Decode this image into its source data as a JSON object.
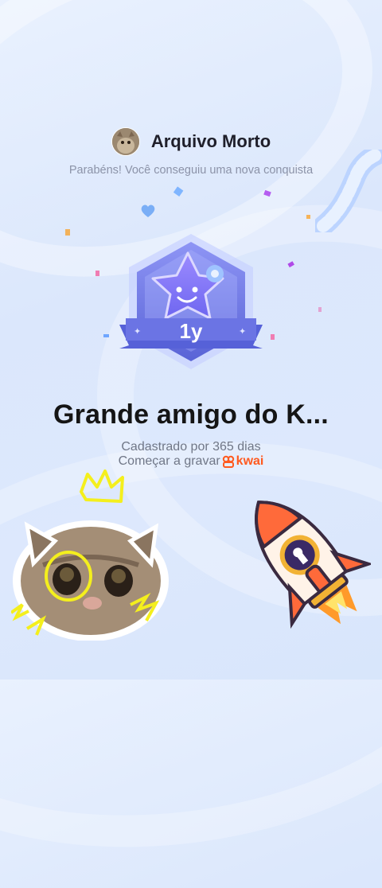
{
  "header": {
    "username": "Arquivo Morto",
    "avatar_icon": "cat-avatar"
  },
  "subtitle": "Parabéns! Você conseguiu uma nova conquista",
  "badge": {
    "label": "1y",
    "icon": "star-mascot-badge",
    "colors": {
      "primary": "#7d7dee",
      "ribbon": "#5661d8",
      "accent": "#9fc3ff"
    }
  },
  "achievement": {
    "title": "Grande amigo do K...",
    "registered_text": "Cadastrado por 365 dias",
    "cta_text": "Começar a gravar",
    "brand_name": "kwai"
  },
  "stickers": {
    "left": "cat-sticker",
    "right": "rocket-sticker"
  },
  "colors": {
    "background": "#dde8fd",
    "brand_orange": "#ff5a1f",
    "title": "#151515",
    "muted_text": "#707787"
  }
}
